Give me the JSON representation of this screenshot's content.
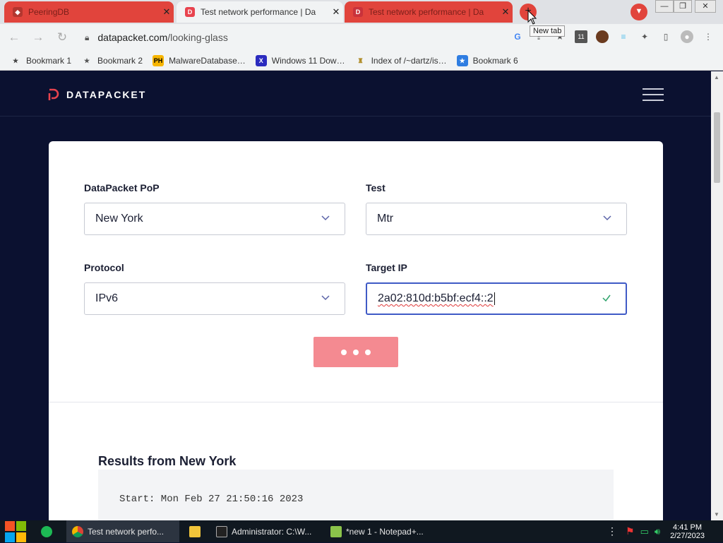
{
  "browser": {
    "tabs": [
      {
        "title": "PeeringDB",
        "close": "✕"
      },
      {
        "title": "Test network performance | Da",
        "close": "✕"
      },
      {
        "title": "Test network performance | Da",
        "close": "✕"
      }
    ],
    "new_tab_tooltip": "New tab",
    "new_tab_symbol": "+",
    "url_host": "datapacket.com",
    "url_path": "/looking-glass",
    "extension_badge": "11",
    "window_controls": [
      "—",
      "❐",
      "✕"
    ]
  },
  "bookmarks": [
    {
      "label": "Bookmark 1",
      "icon_color": "#444444",
      "icon_glyph": "★"
    },
    {
      "label": "Bookmark 2",
      "icon_color": "#555555",
      "icon_glyph": "★"
    },
    {
      "label": "MalwareDatabase…",
      "icon_color": "#f7b500",
      "icon_glyph": "PH"
    },
    {
      "label": "Windows 11 Dow…",
      "icon_color": "#2b2bbf",
      "icon_glyph": "X"
    },
    {
      "label": "Index of /~dartz/is…",
      "icon_color": "#b08d2a",
      "icon_glyph": "♜"
    },
    {
      "label": "Bookmark 6",
      "icon_color": "#2f7de1",
      "icon_glyph": "★"
    }
  ],
  "site": {
    "brand": "DATAPACKET",
    "accent": "#e8434e"
  },
  "form": {
    "pop_label": "DataPacket PoP",
    "pop_value": "New York",
    "test_label": "Test",
    "test_value": "Mtr",
    "protocol_label": "Protocol",
    "protocol_value": "IPv6",
    "target_label": "Target IP",
    "target_value": "2a02:810d:b5bf:ecf4::2"
  },
  "results": {
    "title": "Results from New York",
    "first_line": "Start: Mon Feb 27 21:50:16 2023"
  },
  "taskbar": {
    "apps": [
      {
        "label": "Test network perfo...",
        "active": true
      },
      {
        "label": "",
        "active": false
      },
      {
        "label": "Administrator: C:\\W...",
        "active": false
      },
      {
        "label": "*new 1 - Notepad+...",
        "active": false
      }
    ],
    "time": "4:41 PM",
    "date": "2/27/2023"
  }
}
